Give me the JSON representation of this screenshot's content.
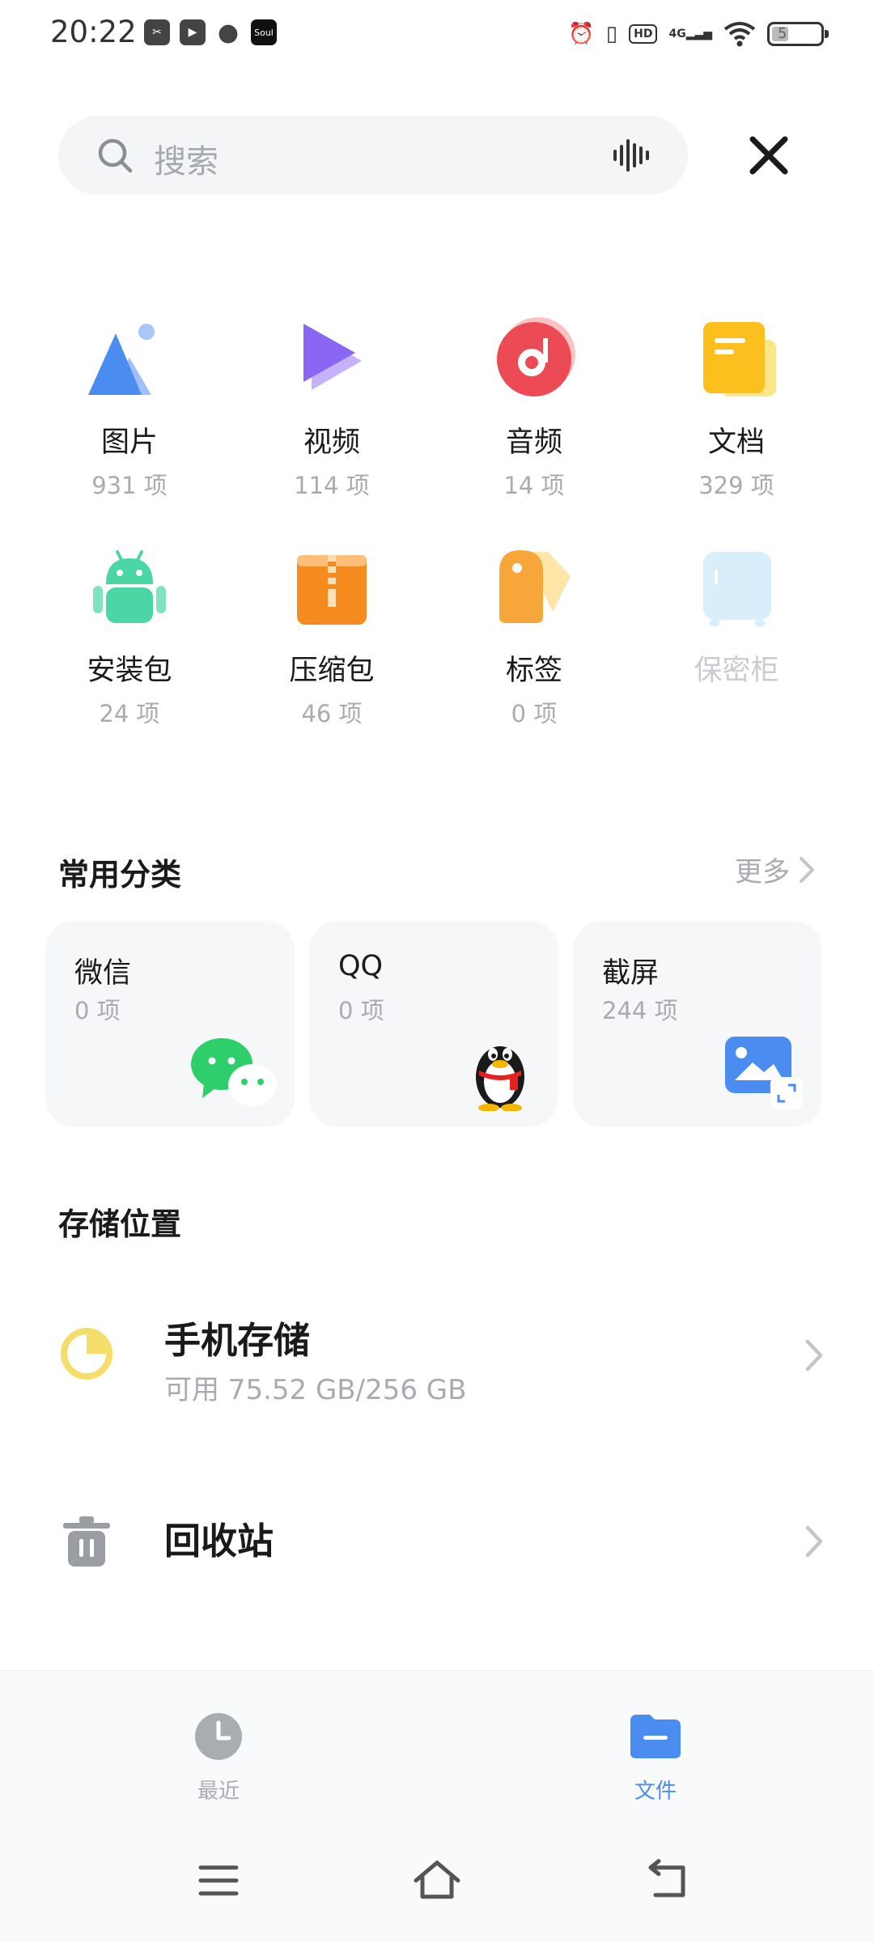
{
  "status_bar": {
    "time": "20:22",
    "notif_soul": "Soul",
    "hd": "HD",
    "network": "4G",
    "battery": "5"
  },
  "search": {
    "placeholder": "搜索"
  },
  "categories": [
    {
      "name": "图片",
      "count": "931 项",
      "icon": "image-icon"
    },
    {
      "name": "视频",
      "count": "114 项",
      "icon": "video-icon"
    },
    {
      "name": "音频",
      "count": "14 项",
      "icon": "audio-icon"
    },
    {
      "name": "文档",
      "count": "329 项",
      "icon": "document-icon"
    },
    {
      "name": "安装包",
      "count": "24 项",
      "icon": "android-icon"
    },
    {
      "name": "压缩包",
      "count": "46 项",
      "icon": "archive-icon"
    },
    {
      "name": "标签",
      "count": "0 项",
      "icon": "tag-icon"
    },
    {
      "name": "保密柜",
      "icon": "safe-icon"
    }
  ],
  "common": {
    "title": "常用分类",
    "more": "更多",
    "cards": [
      {
        "name": "微信",
        "count": "0 项",
        "icon": "wechat-icon"
      },
      {
        "name": "QQ",
        "count": "0 项",
        "icon": "qq-icon"
      },
      {
        "name": "截屏",
        "count": "244 项",
        "icon": "screenshot-icon"
      }
    ]
  },
  "storage": {
    "title": "存储位置",
    "phone": {
      "name": "手机存储",
      "detail": "可用 75.52 GB/256 GB"
    },
    "recycle": {
      "name": "回收站"
    }
  },
  "bottom_nav": {
    "recent": "最近",
    "files": "文件",
    "active": "files"
  },
  "colors": {
    "accent": "#4a8cf0",
    "muted": "#a8abb0"
  }
}
